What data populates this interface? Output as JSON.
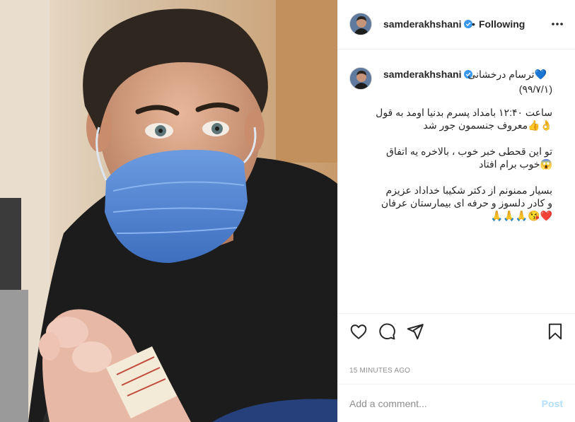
{
  "post": {
    "username": "samderakhshani",
    "separator": "•",
    "follow_status": "Following",
    "caption": {
      "username": "samderakhshani",
      "lines": [
        "💙ترسام درخشانی",
        "(۹۹/۷/۱)",
        "ساعت ۱۲:۴۰ بامداد پسرم بدنیا اومد به قول",
        "👌👍معروف جنسمون جور شد",
        "تو این قحطی خبر خوب ، بالاخره یه اتفاق",
        "😱خوب برام افتاد",
        "بسیار ممنونم از دکتر شکیبا خداداد عزیزم",
        "و کادر دلسوز و حرفه ای بیمارستان عرفان",
        "❤️😘🙏🙏🙏"
      ]
    },
    "timestamp": "15 MINUTES AGO",
    "comment": {
      "placeholder": "Add a comment...",
      "post_label": "Post"
    }
  },
  "icons": {
    "verified": "verified-badge-icon",
    "more": "more-options-icon",
    "like": "heart-icon",
    "comment": "comment-bubble-icon",
    "share": "paper-plane-icon",
    "save": "bookmark-icon"
  },
  "colors": {
    "verified": "#3897f0",
    "post_disabled": "#b2dffc",
    "muted": "#8e8e8e",
    "text": "#262626"
  }
}
